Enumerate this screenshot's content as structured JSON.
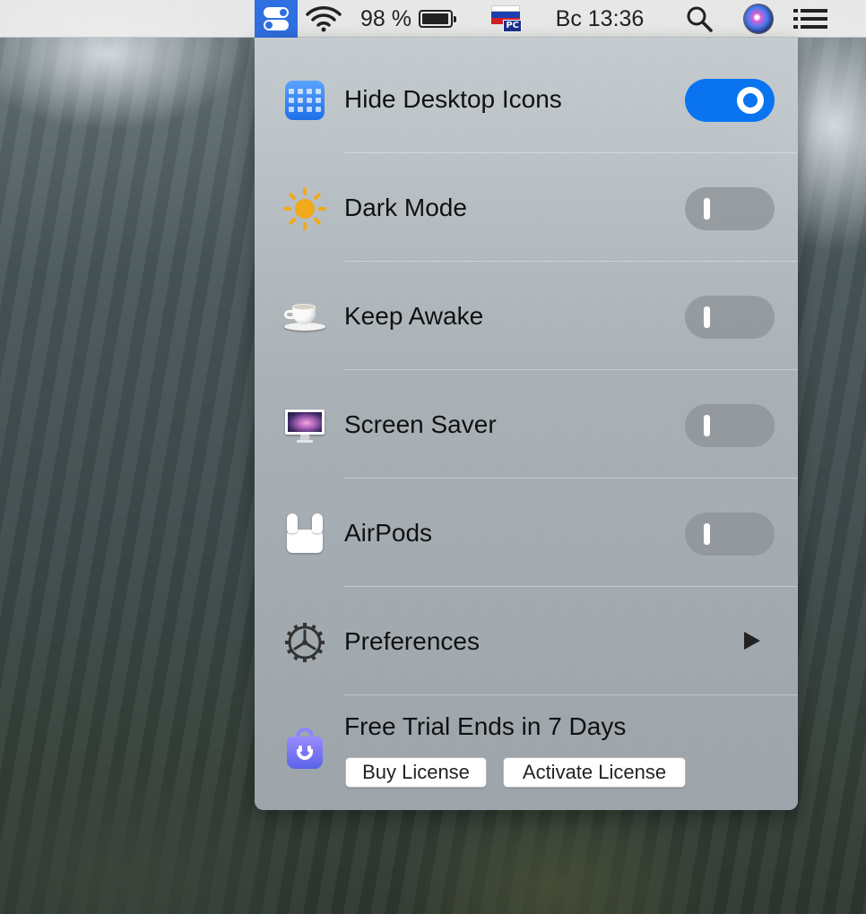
{
  "menubar": {
    "battery_text": "98 %",
    "keyboard_layout_badge": "PC",
    "clock": "Вс 13:36",
    "icons": [
      "one-switch-icon",
      "wifi-icon",
      "battery-icon",
      "russian-flag-icon",
      "search-icon",
      "siri-icon",
      "list-icon"
    ]
  },
  "menu": {
    "items": [
      {
        "label": "Hide Desktop Icons",
        "icon": "desktop-grid-icon",
        "state": "on"
      },
      {
        "label": "Dark Mode",
        "icon": "sun-icon",
        "state": "off"
      },
      {
        "label": "Keep Awake",
        "icon": "coffee-cup-icon",
        "state": "off"
      },
      {
        "label": "Screen Saver",
        "icon": "imac-icon",
        "state": "off"
      },
      {
        "label": "AirPods",
        "icon": "airpods-icon",
        "state": "off"
      },
      {
        "label": "Preferences",
        "icon": "gear-icon",
        "has_submenu": true
      }
    ],
    "trial": {
      "title": "Free Trial Ends in 7 Days",
      "buy_label": "Buy License",
      "activate_label": "Activate License",
      "icon": "shopping-bag-icon"
    }
  },
  "colors": {
    "accent": "#0a74f0",
    "menubar_app_highlight": "#2f6fe0",
    "sun": "#f2a91a"
  }
}
